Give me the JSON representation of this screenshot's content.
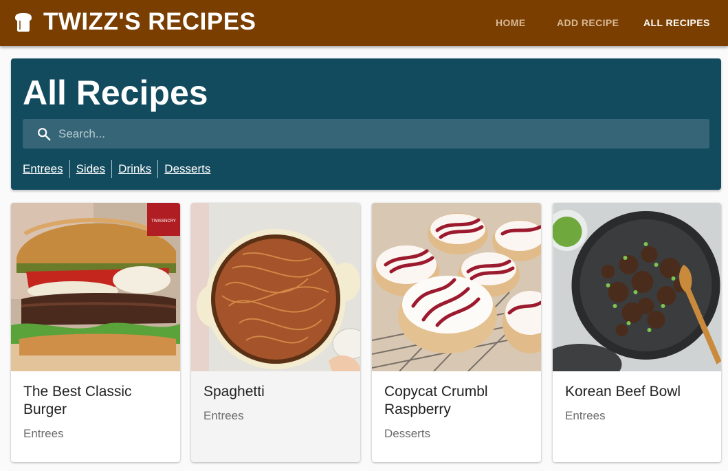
{
  "header": {
    "brand_title": "TWIZZ'S RECIPES",
    "brand_icon": "bread-icon",
    "nav": [
      {
        "label": "HOME",
        "active": false
      },
      {
        "label": "ADD RECIPE",
        "active": false
      },
      {
        "label": "ALL RECIPES",
        "active": true
      }
    ],
    "colors": {
      "bar": "#7a3f00",
      "nav_inactive": "#d9b999",
      "nav_active": "#ffffff"
    }
  },
  "panel": {
    "title": "All Recipes",
    "search": {
      "placeholder": "Search...",
      "value": "",
      "icon": "search-icon"
    },
    "categories": [
      "Entrees",
      "Sides",
      "Drinks",
      "Desserts"
    ],
    "color": "#124b5e"
  },
  "recipes": [
    {
      "title": "The Best Classic Burger",
      "category": "Entrees",
      "image": "burger-photo",
      "watermark": "TWISSNCRY"
    },
    {
      "title": "Spaghetti",
      "category": "Entrees",
      "image": "spaghetti-photo"
    },
    {
      "title": "Copycat Crumbl Raspberry",
      "category": "Desserts",
      "image": "cookies-photo"
    },
    {
      "title": "Korean Beef Bowl",
      "category": "Entrees",
      "image": "beef-photo"
    }
  ]
}
